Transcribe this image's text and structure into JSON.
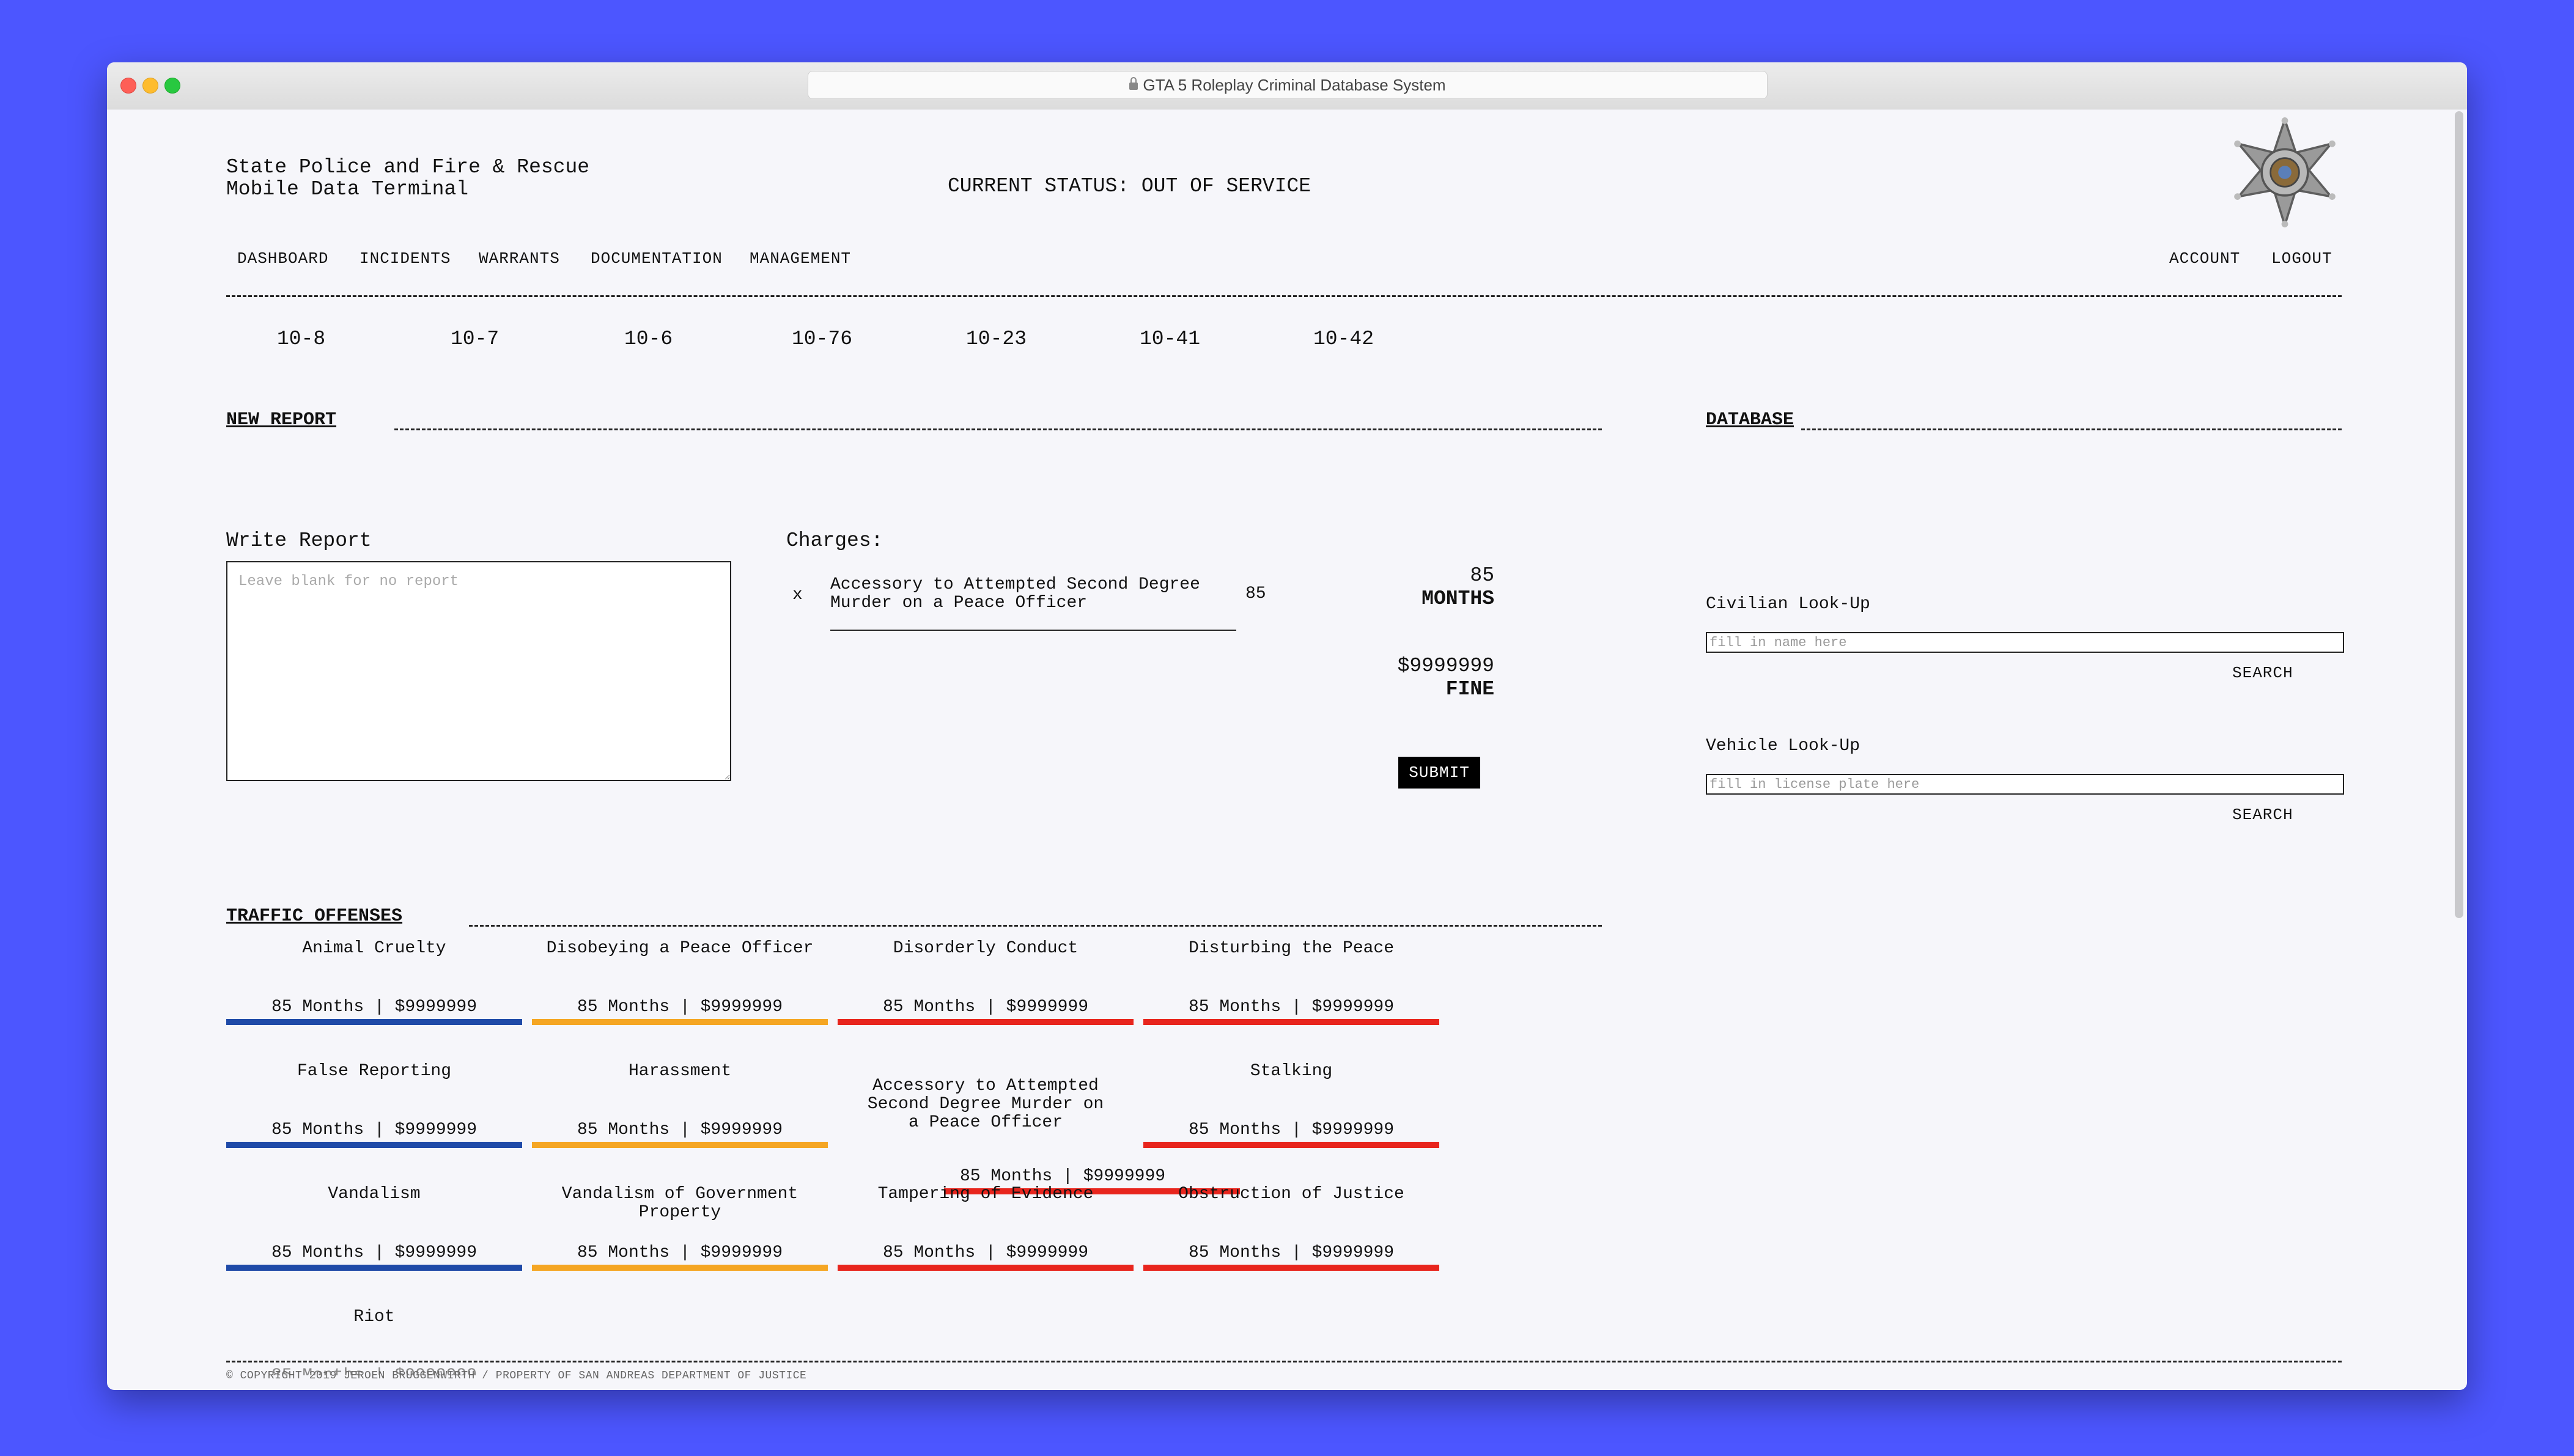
{
  "window": {
    "url": "GTA 5 Roleplay Criminal Database System"
  },
  "header": {
    "title": "State Police and Fire & Rescue\nMobile Data Terminal",
    "status": "CURRENT STATUS: OUT OF SERVICE"
  },
  "nav": {
    "left": [
      "DASHBOARD",
      "INCIDENTS",
      "WARRANTS",
      "DOCUMENTATION",
      "MANAGEMENT"
    ],
    "right": [
      "ACCOUNT",
      "LOGOUT"
    ]
  },
  "codes": [
    "10-8",
    "10-7",
    "10-6",
    "10-76",
    "10-23",
    "10-41",
    "10-42"
  ],
  "report": {
    "section": "NEW REPORT",
    "write_label": "Write Report",
    "placeholder": "Leave blank for no report",
    "charges_label": "Charges:",
    "charges": [
      {
        "remove": "x",
        "name": "Accessory to Attempted Second Degree Murder on a Peace Officer",
        "months": "85"
      }
    ],
    "total_months": "85",
    "months_label": "MONTHS",
    "total_fine": "$9999999",
    "fine_label": "FINE",
    "submit": "SUBMIT"
  },
  "database": {
    "section": "DATABASE",
    "civilian_label": "Civilian Look-Up",
    "civilian_placeholder": "fill in name here",
    "vehicle_label": "Vehicle Look-Up",
    "vehicle_placeholder": "fill in license plate here",
    "search": "SEARCH"
  },
  "offenses": {
    "section": "TRAFFIC OFFENSES",
    "items": [
      {
        "name": "Animal Cruelty",
        "price": "85 Months | $9999999",
        "color": "#1f4aa8"
      },
      {
        "name": "Disobeying a Peace Officer",
        "price": "85 Months | $9999999",
        "color": "#f5a623"
      },
      {
        "name": "Disorderly Conduct",
        "price": "85 Months | $9999999",
        "color": "#e8251d"
      },
      {
        "name": "Disturbing the Peace",
        "price": "85 Months | $9999999",
        "color": "#e8251d"
      },
      {
        "name": "False Reporting",
        "price": "85 Months | $9999999",
        "color": "#1f4aa8"
      },
      {
        "name": "Harassment",
        "price": "85 Months | $9999999",
        "color": "#f5a623"
      },
      {
        "name": "Accessory to Attempted Second Degree Murder on a Peace Officer",
        "price": "",
        "color": ""
      },
      {
        "name": "Stalking",
        "price": "85 Months | $9999999",
        "color": "#e8251d"
      },
      {
        "name": "Vandalism",
        "price": "85 Months | $9999999",
        "color": "#1f4aa8"
      },
      {
        "name": "Vandalism of Government Property",
        "price": "85 Months | $9999999",
        "color": "#f5a623"
      },
      {
        "name": "Tampering of Evidence",
        "price": "85 Months | $9999999",
        "color": "#e8251d"
      },
      {
        "name": "Obstruction of Justice",
        "price": "85 Months | $9999999",
        "color": "#e8251d"
      },
      {
        "name": "Riot",
        "price": "85 Months | $9999999",
        "color": ""
      }
    ]
  },
  "footer": "© COPYRIGHT 2019 JEROEN BRUGGENWIRTH / PROPERTY OF SAN ANDREAS DEPARTMENT OF JUSTICE"
}
